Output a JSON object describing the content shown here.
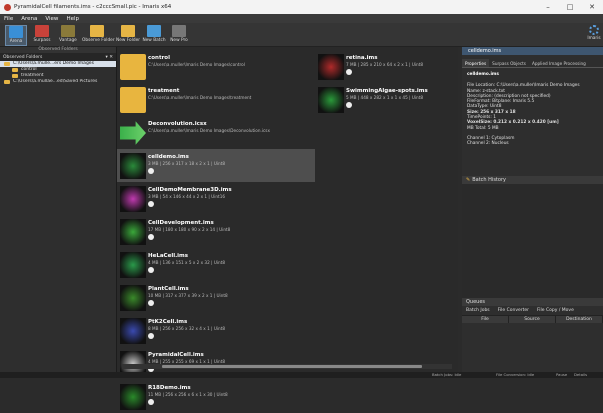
{
  "window": {
    "title": "PyramidalCell filaments.ims - c2cccSmall.pic - Imaris x64",
    "min": "–",
    "max": "□",
    "close": "✕"
  },
  "menu": [
    "File",
    "Arena",
    "View",
    "Help"
  ],
  "toolbar": [
    {
      "label": "Arena",
      "color": "#3a8fd6"
    },
    {
      "label": "Surpass",
      "color": "#c9423a"
    },
    {
      "label": "Vantage",
      "color": "#8a7a3a"
    },
    {
      "label": "Observe Folder",
      "color": "#e6b545"
    },
    {
      "label": "New Folder",
      "color": "#e6b545"
    },
    {
      "label": "New Batch",
      "color": "#4a9ad6"
    },
    {
      "label": "New Pro",
      "color": "#777777"
    }
  ],
  "toolbar_right": "Imaris",
  "left": {
    "heading": "Observed Folders",
    "bar_label": "Observed Folders",
    "tree": [
      "C:\\Users\\a.mulle...ers Demo Images",
      "control",
      "treatment",
      "C:\\Users\\a.mullae...ed\\Saved Pictures"
    ]
  },
  "files_left": [
    {
      "name": "control",
      "meta": "C:\\Users\\a.muller\\Imaris Demo Images\\control",
      "kind": "folder"
    },
    {
      "name": "treatment",
      "meta": "C:\\Users\\a.muller\\Imaris Demo Images\\treatment",
      "kind": "folder"
    },
    {
      "name": "Deconvolution.icsx",
      "meta": "C:\\Users\\a.muller\\Imaris Demo Images\\Deconvolution.icsx",
      "kind": "arrow"
    },
    {
      "name": "celldemo.ims",
      "meta": "3 MB | 256 x 317 x 18 x 2 x 1 | Uint8",
      "kind": "cell",
      "color": "#2a8a3a"
    },
    {
      "name": "CellDemoMembrane3D.ims",
      "meta": "3 MB | 54 x 146 x 44 x 2 x 1 | Uint16",
      "kind": "cell",
      "color": "#c03ab0"
    },
    {
      "name": "CellDevelopment.ims",
      "meta": "17 MB | 180 x 180 x 90 x 2 x 14 | Uint8",
      "kind": "cell",
      "color": "#3aa83a"
    },
    {
      "name": "HeLaCell.ims",
      "meta": "4 MB | 136 x 151 x 5 x 2 x 32 | Uint8",
      "kind": "cell",
      "color": "#2a9a4a"
    },
    {
      "name": "PlantCell.ims",
      "meta": "10 MB | 317 x 377 x 39 x 2 x 1 | Uint8",
      "kind": "cell",
      "color": "#3a8a2a"
    },
    {
      "name": "PtK2Cell.ims",
      "meta": "8 MB | 256 x 256 x 32 x 4 x 1 | Uint8",
      "kind": "cell",
      "color": "#3a4ab0"
    },
    {
      "name": "PyramidalCell.ims",
      "meta": "4 MB | 255 x 255 x 69 x 1 x 1 | Uint8",
      "kind": "cell",
      "color": "#c8c8c8"
    },
    {
      "name": "R18Demo.ims",
      "meta": "11 MB | 256 x 256 x 6 x 1 x 30 | Uint8",
      "kind": "cell",
      "color": "#2a8a2a"
    }
  ],
  "files_right": [
    {
      "name": "retina.ims",
      "meta": "7 MB | 285 x 210 x 64 x 2 x 1 | Uint8",
      "color": "#b02a2a"
    },
    {
      "name": "SwimmingAlgae-spots.ims",
      "meta": "5 MB | 448 x 282 x 1 x 1 x 45 | Uint8",
      "color": "#2a9a3a"
    }
  ],
  "right": {
    "title": "celldemo.ims",
    "tabs": [
      "Properties",
      "Surpass Objects",
      "Applied Image Processing"
    ],
    "props_heading": "celldemo.ims",
    "props": [
      "File Location: C:\\Users\\a.muller\\Imaris Demo Images",
      "Name: z-stack.txt",
      "Description: (description not specified)",
      "FileFormat: Bitplane: Imaris 5.5",
      "DataType: Uint8",
      "Size: 256 x 317 x 18",
      "TimePoints: 1",
      "VoxelSize: 0.212 x 0.212 x 0.420 [um]",
      "MB Total: 5 MB",
      "",
      "Channel 1: Cytoplasm",
      "Channel 2: Nucleus"
    ],
    "batch_history": "Batch History",
    "queues": "Queues",
    "queue_tabs": [
      "Batch Jobs",
      "File Converter",
      "File Copy / Move"
    ],
    "queue_cols": [
      "File",
      "Source",
      "Destination"
    ]
  },
  "status": [
    "Batch Jobs: Idle",
    "File Conversion: Idle",
    "Pause",
    "Details"
  ]
}
